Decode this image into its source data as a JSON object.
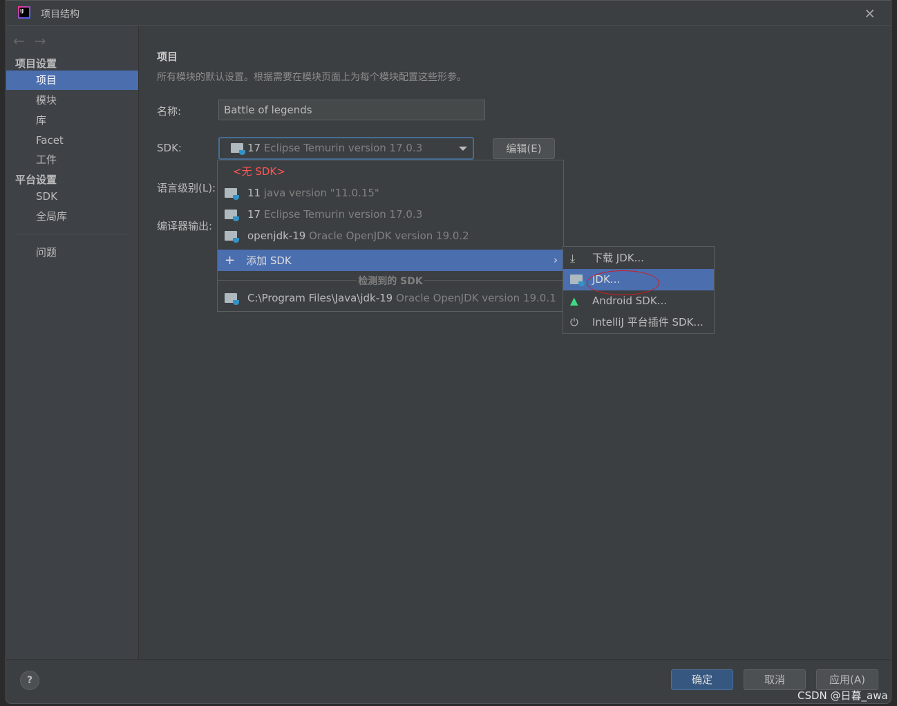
{
  "window": {
    "title": "项目结构",
    "close_icon": "×"
  },
  "sidebar": {
    "nav_back": "←",
    "nav_forward": "→",
    "section1": "项目设置",
    "items1": [
      "项目",
      "模块",
      "库",
      "Facet",
      "工件"
    ],
    "section2": "平台设置",
    "items2": [
      "SDK",
      "全局库"
    ],
    "problems": "问题"
  },
  "main": {
    "heading": "项目",
    "description": "所有模块的默认设置。根据需要在模块页面上为每个模块配置这些形参。",
    "name_label": "名称:",
    "name_value": "Battle of legends",
    "sdk_label": "SDK:",
    "sdk_selected_ver": "17",
    "sdk_selected_desc": "Eclipse Temurin version 17.0.3",
    "edit_button": "编辑(E)",
    "language_label": "语言级别(L):",
    "compiler_label": "编译器输出:"
  },
  "dropdown": {
    "no_sdk": "<无 SDK>",
    "items": [
      {
        "name": "11",
        "desc": "java version \"11.0.15\""
      },
      {
        "name": "17",
        "desc": "Eclipse Temurin version 17.0.3"
      },
      {
        "name": "openjdk-19",
        "desc": "Oracle OpenJDK version 19.0.2"
      }
    ],
    "add_sdk": "添加 SDK",
    "detected_header": "检测到的 SDK",
    "detected": [
      {
        "name": "C:\\Program Files\\Java\\jdk-19",
        "desc": "Oracle OpenJDK version 19.0.1"
      }
    ]
  },
  "submenu": {
    "items": [
      "下载 JDK...",
      "JDK...",
      "Android SDK...",
      "IntelliJ 平台插件 SDK..."
    ],
    "selected": 1,
    "highlight_color": "#d21c1c"
  },
  "footer": {
    "help": "?",
    "ok": "确定",
    "cancel": "取消",
    "apply": "应用(A)"
  },
  "watermark": "CSDN @日暮_awa",
  "colors": {
    "selection": "#4b6eaf",
    "no_sdk": "#ff5555",
    "primary_button": "#365880"
  }
}
